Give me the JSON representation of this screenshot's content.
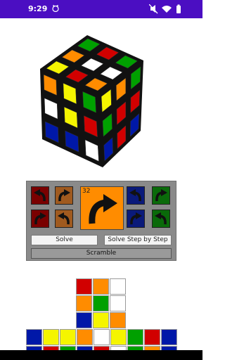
{
  "status_bar": {
    "time": "9:29",
    "icons": [
      "cat-icon",
      "mute-icon",
      "wifi-icon",
      "battery-icon"
    ]
  },
  "controls": {
    "move_counter": "32",
    "solve_label": "Solve",
    "solve_step_label": "Solve Step by Step",
    "scramble_label": "Scramble",
    "face_buttons": [
      {
        "face": "red",
        "color": "#7a0000",
        "direction": "counter-clockwise"
      },
      {
        "face": "orange",
        "color": "#a05a1f",
        "direction": "clockwise"
      },
      {
        "face": "red",
        "color": "#7a0000",
        "direction": "clockwise"
      },
      {
        "face": "orange",
        "color": "#a05a1f",
        "direction": "counter-clockwise"
      },
      {
        "face": "blue",
        "color": "#0a1a7a",
        "direction": "counter-clockwise"
      },
      {
        "face": "green",
        "color": "#0a6a0a",
        "direction": "clockwise"
      },
      {
        "face": "blue",
        "color": "#0a1a7a",
        "direction": "clockwise"
      },
      {
        "face": "green",
        "color": "#0a6a0a",
        "direction": "counter-clockwise"
      }
    ],
    "big_button_color": "#ff8c00"
  },
  "palette": {
    "W": "#ffffff",
    "Y": "#f5f500",
    "R": "#d10000",
    "O": "#ff8c00",
    "G": "#00a000",
    "B": "#0018a8"
  },
  "cube3d": {
    "top": [
      [
        "Y",
        "O",
        "G"
      ],
      [
        "R",
        "W",
        "R"
      ],
      [
        "O",
        "W",
        "G"
      ]
    ],
    "left": [
      [
        "O",
        "Y",
        "G"
      ],
      [
        "W",
        "Y",
        "R"
      ],
      [
        "B",
        "B",
        "W"
      ]
    ],
    "right": [
      [
        "Y",
        "O",
        "G"
      ],
      [
        "G",
        "R",
        "R"
      ],
      [
        "B",
        "R",
        "B"
      ]
    ]
  },
  "net": {
    "upper": [
      [
        "R",
        "O",
        "W"
      ],
      [
        "O",
        "G",
        "W"
      ],
      [
        "B",
        "Y",
        "O"
      ]
    ],
    "band": [
      [
        "B",
        "Y",
        "Y",
        "O",
        "W",
        "Y",
        "G",
        "R",
        "B"
      ],
      [
        "B",
        "R",
        "G",
        "B",
        "R",
        "W",
        "G",
        "O",
        "B"
      ]
    ]
  }
}
